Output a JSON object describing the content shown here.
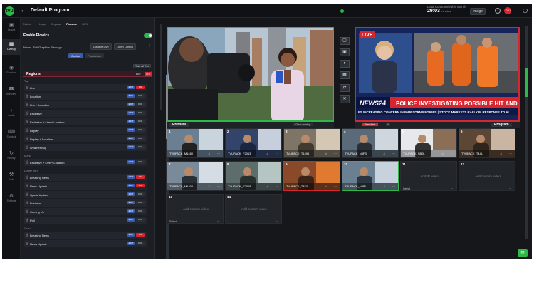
{
  "header": {
    "logo": "tvu",
    "back_icon": "arrow-left-icon",
    "title": "Default Program",
    "time_label": "Data Consumed this Month",
    "time_value": "29:03",
    "time_unit": "minutes",
    "image_button": "Image",
    "avatar_initials": "TVU",
    "power_icon": "power-icon"
  },
  "nav": [
    {
      "label": "Output",
      "icon": "output-icon"
    },
    {
      "label": "Overlay",
      "icon": "overlay-icon",
      "active": true
    },
    {
      "label": "Graphics",
      "icon": "graphics-icon"
    },
    {
      "label": "Interview",
      "icon": "interview-icon"
    },
    {
      "label": "Audio",
      "icon": "audio-icon"
    },
    {
      "label": "Shortcut",
      "icon": "shortcut-icon"
    },
    {
      "label": "Replay",
      "icon": "replay-icon"
    },
    {
      "label": "Tools",
      "icon": "tools-icon"
    },
    {
      "label": "Settings",
      "icon": "settings-icon"
    }
  ],
  "panel": {
    "tabs": [
      "Native",
      "Logo",
      "Singular",
      "Flowics",
      "GFX"
    ],
    "active_tab": "Flowics",
    "enable_label": "Enable Flowics",
    "package_label": "News - Full Graphics Package",
    "disable_live": "Disable Live",
    "open_output": "Open Output",
    "control_tab": "Control",
    "production_tab": "Production",
    "take_all": "Take All Out",
    "regions_label": "Regions",
    "regions_badge1": "EDIT",
    "regions_badge2": "OUT",
    "groups": [
      {
        "label": "Top",
        "rows": [
          "Live",
          "Location",
          "Live + Location",
          "Exclusive",
          "Exclusive + Live + Location",
          "Replay",
          "Replay + Location",
          "Weather Bug"
        ]
      },
      {
        "label": "Mark",
        "rows": [
          "Exclusive + Live + Location"
        ]
      },
      {
        "label": "Lower third",
        "rows": [
          "Breaking News",
          "News Update",
          "Sports Update",
          "Business",
          "Coming Up",
          "Poll"
        ]
      },
      {
        "label": "Crawl",
        "rows": [
          "Breaking News",
          "News Update"
        ]
      }
    ],
    "edit_badge": "EDIT",
    "on_badge": "ON",
    "off_badge": "OFF"
  },
  "monitors": {
    "preview_label": "Preview",
    "clear_label": "Clear overlay",
    "program_label": "Program",
    "transition_label": "Transition",
    "x_label": "X",
    "program_live_badge": "LIVE",
    "program_channel": "NEWS24",
    "program_headline": "POLICE INVESTIGATING POSSIBLE HIT AND RUN",
    "program_ticker": "ES INCREASING CONCERN IN WAR-TORN REGIONS | STOCK MARKETS RALLY IN RESPONSE TO AI"
  },
  "tiles": [
    {
      "num": "1",
      "cap": "TVUPACK_M1480",
      "state": ""
    },
    {
      "num": "2",
      "cap": "TVUPACK_Y2013",
      "state": ""
    },
    {
      "num": "3",
      "cap": "TVUPACK_T1496",
      "state": ""
    },
    {
      "num": "4",
      "cap": "TVUPACK_N5FS",
      "state": ""
    },
    {
      "num": "5",
      "cap": "TVUPACK_SB0L",
      "state": ""
    },
    {
      "num": "6",
      "cap": "TVUPACK_T44L",
      "state": ""
    },
    {
      "num": "7",
      "cap": "TVUPACK_M1400",
      "state": ""
    },
    {
      "num": "8",
      "cap": "TVUPACK_Y2015",
      "state": ""
    },
    {
      "num": "9",
      "cap": "TVUPACK_T4KS",
      "state": "prog"
    },
    {
      "num": "10",
      "cap": "TVUPACK_N5BL",
      "state": "prev"
    },
    {
      "num": "11",
      "cap": "Add IP video",
      "state": "empty"
    },
    {
      "num": "12",
      "cap": "Add custom video",
      "state": "empty"
    },
    {
      "num": "13",
      "cap": "Add custom video",
      "state": "empty"
    },
    {
      "num": "14",
      "cap": "Add custom video",
      "state": "empty"
    }
  ],
  "select_label": "Select",
  "colors": {
    "accent_green": "#2fb84a",
    "live_red": "#d8262f",
    "bg": "#15171b"
  }
}
